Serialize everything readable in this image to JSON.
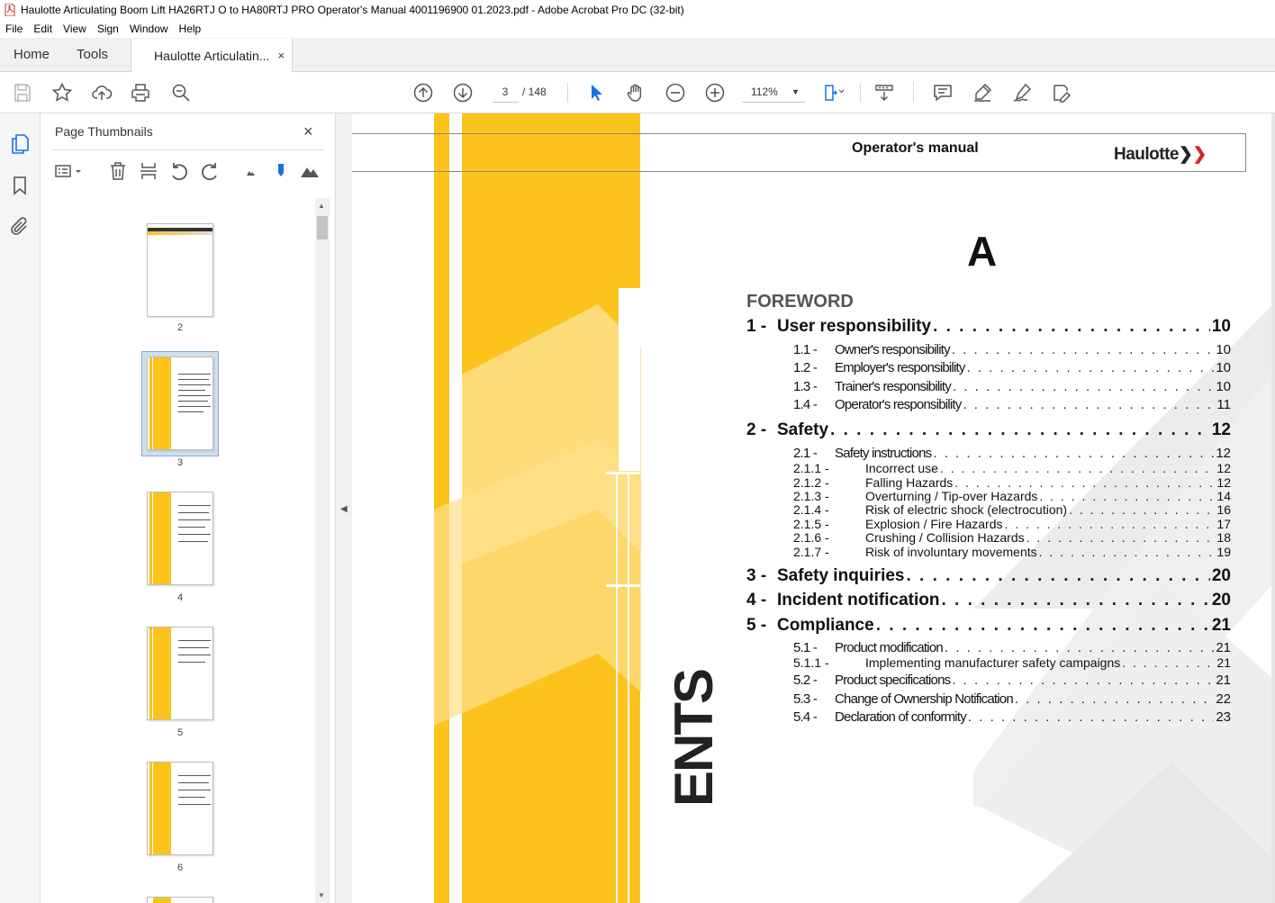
{
  "window": {
    "title": "Haulotte Articulating Boom Lift HA26RTJ O to HA80RTJ PRO Operator's Manual 4001196900 01.2023.pdf - Adobe Acrobat Pro DC (32-bit)"
  },
  "menu": [
    "File",
    "Edit",
    "View",
    "Sign",
    "Window",
    "Help"
  ],
  "tabs": {
    "home": "Home",
    "tools": "Tools",
    "document": "Haulotte Articulatin...",
    "close": "×"
  },
  "toolbar": {
    "current_page": "3",
    "total_pages": "/ 148",
    "zoom": "112%",
    "icons": [
      "save-icon",
      "star-icon",
      "upload-icon",
      "print-icon",
      "find-icon",
      "page-up-icon",
      "page-down-icon",
      "select-icon",
      "hand-icon",
      "zoom-out-icon",
      "zoom-in-icon",
      "fit-page-icon",
      "scroll-mode-icon",
      "comment-icon",
      "highlight-icon",
      "sign-icon",
      "edit-icon"
    ]
  },
  "thumbnails": {
    "title": "Page Thumbnails",
    "close": "×",
    "pages": [
      {
        "label": "2"
      },
      {
        "label": "3"
      },
      {
        "label": "4"
      },
      {
        "label": "5"
      },
      {
        "label": "6"
      }
    ]
  },
  "document": {
    "header_title": "Operator's manual",
    "logo": "Haulotte",
    "section_letter": "A",
    "vertical_word": "ENTS",
    "foreword": "FOREWORD",
    "toc": [
      {
        "level": 1,
        "num": "1 -",
        "label": "User responsibility",
        "page": "10"
      },
      {
        "level": 2,
        "num": "1.1 -",
        "label": "Owner's responsibility",
        "page": "10"
      },
      {
        "level": 2,
        "num": "1.2 -",
        "label": "Employer's responsibility",
        "page": "10"
      },
      {
        "level": 2,
        "num": "1.3 -",
        "label": "Trainer's responsibility",
        "page": "10"
      },
      {
        "level": 2,
        "num": "1.4 -",
        "label": "Operator's responsibility",
        "page": "11"
      },
      {
        "level": 1,
        "num": "2 -",
        "label": "Safety",
        "page": "12"
      },
      {
        "level": 2,
        "num": "2.1 -",
        "label": "Safety instructions",
        "page": "12"
      },
      {
        "level": 3,
        "num": "2.1.1 -",
        "label": "Incorrect use",
        "page": "12"
      },
      {
        "level": 3,
        "num": "2.1.2 -",
        "label": "Falling Hazards",
        "page": "12"
      },
      {
        "level": 3,
        "num": "2.1.3 -",
        "label": "Overturning / Tip-over Hazards",
        "page": "14"
      },
      {
        "level": 3,
        "num": "2.1.4 -",
        "label": "Risk of electric shock (electrocution)",
        "page": "16"
      },
      {
        "level": 3,
        "num": "2.1.5 -",
        "label": "Explosion / Fire Hazards",
        "page": "17"
      },
      {
        "level": 3,
        "num": "2.1.6 -",
        "label": "Crushing / Collision Hazards",
        "page": "18"
      },
      {
        "level": 3,
        "num": "2.1.7 -",
        "label": "Risk of involuntary movements",
        "page": "19"
      },
      {
        "level": 1,
        "num": "3 -",
        "label": "Safety inquiries",
        "page": "20"
      },
      {
        "level": 1,
        "num": "4 -",
        "label": "Incident notification",
        "page": "20"
      },
      {
        "level": 1,
        "num": "5 -",
        "label": "Compliance",
        "page": "21"
      },
      {
        "level": 2,
        "num": "5.1 -",
        "label": "Product modification",
        "page": "21"
      },
      {
        "level": 3,
        "num": "5.1.1 -",
        "label": "Implementing manufacturer safety campaigns",
        "page": "21"
      },
      {
        "level": 2,
        "num": "5.2 -",
        "label": "Product specifications",
        "page": "21"
      },
      {
        "level": 2,
        "num": "5.3 -",
        "label": "Change of Ownership Notification",
        "page": "22"
      },
      {
        "level": 2,
        "num": "5.4 -",
        "label": "Declaration of conformity",
        "page": "23"
      }
    ]
  },
  "colors": {
    "brand_yellow": "#fbc31c",
    "logo_red": "#d9252a",
    "selection_blue": "#1473e6"
  }
}
